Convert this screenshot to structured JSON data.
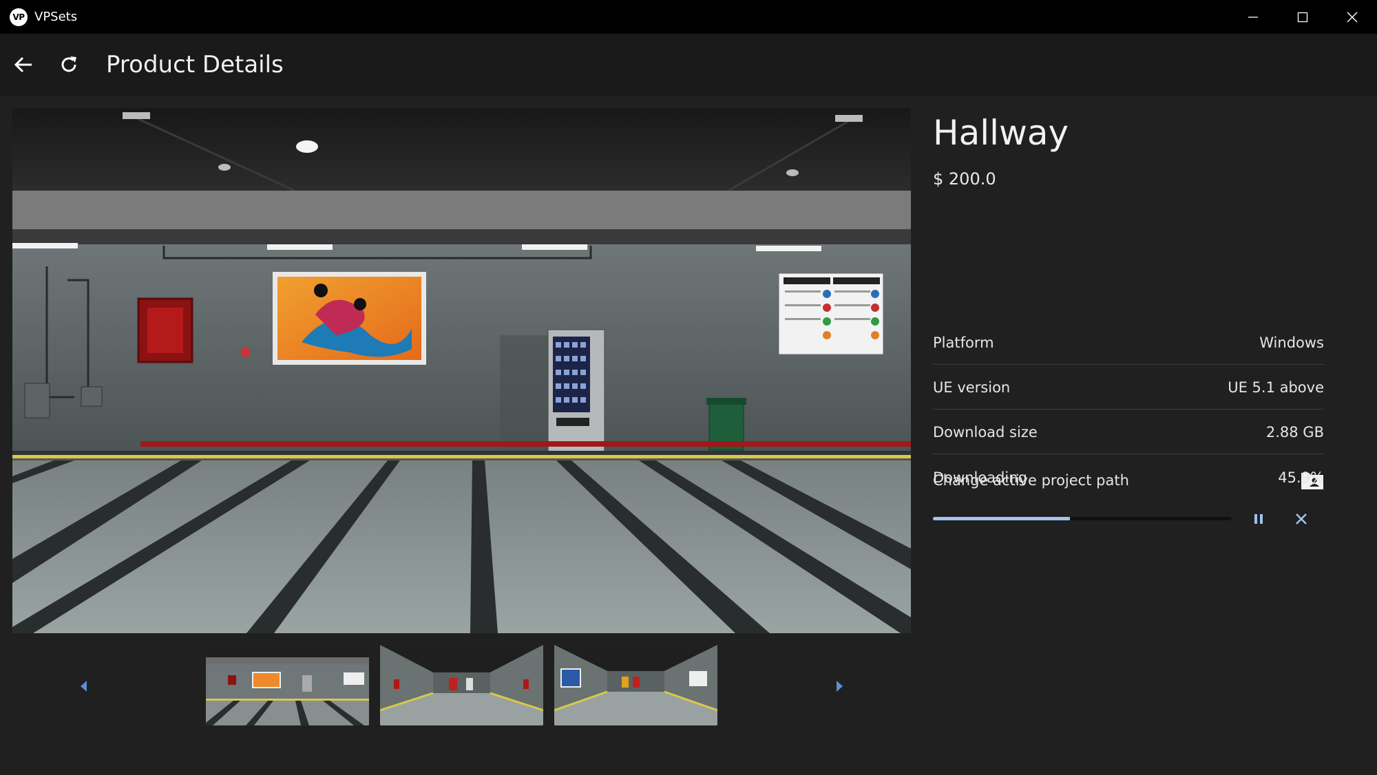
{
  "app": {
    "logo_text": "VP",
    "title": "VPSets"
  },
  "window_controls": {
    "icons": [
      "minimize-icon",
      "maximize-icon",
      "close-icon"
    ]
  },
  "header": {
    "back_icon": "arrow-left-icon",
    "refresh_icon": "refresh-icon",
    "title": "Product Details"
  },
  "gallery": {
    "prev_icon": "caret-left-icon",
    "next_icon": "caret-right-icon",
    "thumbnail_count": 3,
    "selected_index": 0
  },
  "product": {
    "name": "Hallway",
    "price": "$ 200.0",
    "specs": [
      {
        "label": "Platform",
        "value": "Windows"
      },
      {
        "label": "UE version",
        "value": "UE 5.1 above"
      },
      {
        "label": "Download size",
        "value": "2.88 GB"
      }
    ],
    "change_path_label": "Change active project path",
    "change_path_icon": "folder-icon"
  },
  "download": {
    "status": "Downloading",
    "percent_label": "45.9%",
    "progress": 0.459,
    "pause_icon": "pause-icon",
    "cancel_icon": "close-icon"
  },
  "colors": {
    "accent": "#9ec4ef",
    "background": "#202020",
    "titlebar": "#000000",
    "header": "#1a1a1a"
  }
}
